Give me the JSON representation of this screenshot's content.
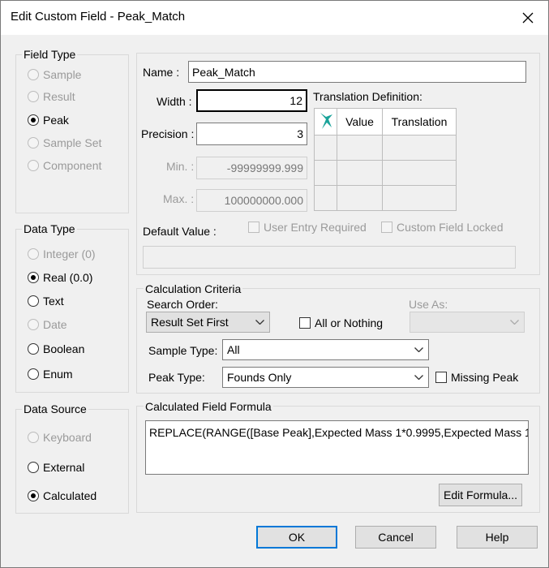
{
  "window": {
    "title": "Edit Custom Field - Peak_Match"
  },
  "field_type": {
    "title": "Field Type",
    "options": [
      {
        "label": "Sample",
        "selected": false,
        "enabled": false
      },
      {
        "label": "Result",
        "selected": false,
        "enabled": false
      },
      {
        "label": "Peak",
        "selected": true,
        "enabled": true
      },
      {
        "label": "Sample Set",
        "selected": false,
        "enabled": false
      },
      {
        "label": "Component",
        "selected": false,
        "enabled": false
      }
    ]
  },
  "data_type": {
    "title": "Data Type",
    "options": [
      {
        "label": "Integer (0)",
        "selected": false,
        "enabled": false
      },
      {
        "label": "Real (0.0)",
        "selected": true,
        "enabled": true
      },
      {
        "label": "Text",
        "selected": false,
        "enabled": true
      },
      {
        "label": "Date",
        "selected": false,
        "enabled": false
      },
      {
        "label": "Boolean",
        "selected": false,
        "enabled": true
      },
      {
        "label": "Enum",
        "selected": false,
        "enabled": true
      }
    ]
  },
  "data_source": {
    "title": "Data Source",
    "options": [
      {
        "label": "Keyboard",
        "selected": false,
        "enabled": false
      },
      {
        "label": "External",
        "selected": false,
        "enabled": true
      },
      {
        "label": "Calculated",
        "selected": true,
        "enabled": true
      }
    ]
  },
  "properties": {
    "name_label": "Name :",
    "name_value": "Peak_Match",
    "width_label": "Width :",
    "width_value": "12",
    "precision_label": "Precision :",
    "precision_value": "3",
    "min_label": "Min. :",
    "min_value": "-99999999.999",
    "max_label": "Max. :",
    "max_value": "100000000.000",
    "default_label": "Default Value :",
    "default_value": "",
    "user_entry_label": "User Entry Required",
    "locked_label": "Custom Field Locked"
  },
  "translation": {
    "title": "Translation Definition:",
    "columns": [
      "Value",
      "Translation"
    ],
    "rows": [
      [
        "",
        ""
      ],
      [
        "",
        ""
      ],
      [
        "",
        ""
      ]
    ]
  },
  "calc": {
    "title": "Calculation Criteria",
    "search_order_label": "Search Order:",
    "search_order_value": "Result Set First",
    "all_or_nothing_label": "All or Nothing",
    "use_as_label": "Use As:",
    "use_as_value": "",
    "sample_type_label": "Sample Type:",
    "sample_type_value": "All",
    "peak_type_label": "Peak Type:",
    "peak_type_value": "Founds Only",
    "missing_peak_label": "Missing Peak"
  },
  "formula": {
    "title": "Calculated Field Formula",
    "text": "REPLACE(RANGE([Base Peak],Expected Mass 1*0.9995,Expected Mass 1",
    "edit_label": "Edit Formula..."
  },
  "buttons": {
    "ok": "OK",
    "cancel": "Cancel",
    "help": "Help"
  },
  "colors": {
    "accent": "#0078d7",
    "icon_teal": "#1aa39a"
  },
  "icons": {
    "close": "close-icon",
    "translation_header": "teal-arrow-icon",
    "dropdown": "chevron-down-icon"
  }
}
